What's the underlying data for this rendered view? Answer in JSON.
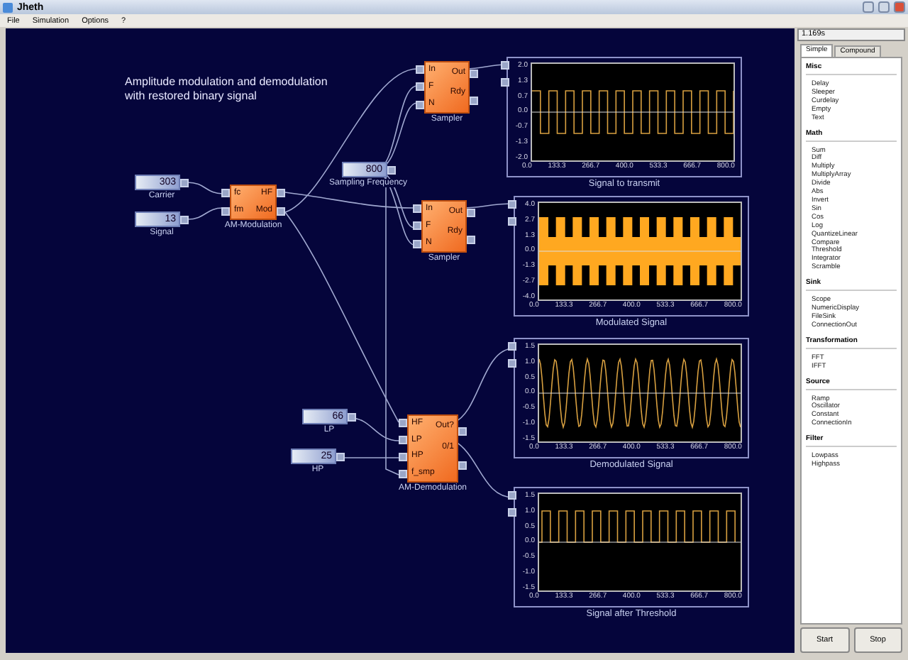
{
  "window": {
    "title": "Jheth"
  },
  "menu": [
    "File",
    "Simulation",
    "Options",
    "?"
  ],
  "canvas": {
    "caption_lines": [
      "Amplitude modulation and demodulation",
      "with restored binary signal"
    ],
    "constants": [
      {
        "label": "Carrier",
        "value": "303"
      },
      {
        "label": "Signal",
        "value": "13"
      },
      {
        "label": "Sampling Frequency",
        "value": "800"
      },
      {
        "label": "LP",
        "value": "66"
      },
      {
        "label": "HP",
        "value": "25"
      }
    ],
    "blocks": [
      {
        "name": "AM-Modulation",
        "inputs": [
          "fc",
          "fm"
        ],
        "outputs": [
          "HF",
          "Mod"
        ]
      },
      {
        "name": "Sampler",
        "inputs": [
          "In",
          "F",
          "N"
        ],
        "outputs": [
          "Out",
          "Rdy"
        ]
      },
      {
        "name": "Sampler",
        "inputs": [
          "In",
          "F",
          "N"
        ],
        "outputs": [
          "Out",
          "Rdy"
        ]
      },
      {
        "name": "AM-Demodulation",
        "inputs": [
          "HF",
          "LP",
          "HP",
          "f_smp"
        ],
        "outputs": [
          "Out?",
          "0/1"
        ]
      }
    ],
    "scopes": [
      {
        "title": "Signal to transmit",
        "kind": "square",
        "yticks": [
          "2.0",
          "1.3",
          "0.7",
          "0.0",
          "-0.7",
          "-1.3",
          "-2.0"
        ],
        "xticks": [
          "0.0",
          "133.3",
          "266.7",
          "400.0",
          "533.3",
          "666.7",
          "800.0"
        ]
      },
      {
        "title": "Modulated Signal",
        "kind": "am",
        "yticks": [
          "4.0",
          "2.7",
          "1.3",
          "0.0",
          "-1.3",
          "-2.7",
          "-4.0"
        ],
        "xticks": [
          "0.0",
          "133.3",
          "266.7",
          "400.0",
          "533.3",
          "666.7",
          "800.0"
        ]
      },
      {
        "title": "Demodulated Signal",
        "kind": "sine",
        "yticks": [
          "1.5",
          "1.0",
          "0.5",
          "0.0",
          "-0.5",
          "-1.0",
          "-1.5"
        ],
        "xticks": [
          "0.0",
          "133.3",
          "266.7",
          "400.0",
          "533.3",
          "666.7",
          "800.0"
        ]
      },
      {
        "title": "Signal after Threshold",
        "kind": "pulse",
        "yticks": [
          "1.5",
          "1.0",
          "0.5",
          "0.0",
          "-0.5",
          "-1.0",
          "-1.5"
        ],
        "xticks": [
          "0.0",
          "133.3",
          "266.7",
          "400.0",
          "533.3",
          "666.7",
          "800.0"
        ]
      }
    ]
  },
  "panel": {
    "time": "1.169s",
    "tabs": [
      {
        "label": "Simple",
        "selected": true
      },
      {
        "label": "Compound",
        "selected": false
      }
    ],
    "groups": [
      {
        "title": "Misc",
        "items": [
          "Delay",
          "Sleeper",
          "Curdelay",
          "Empty",
          "Text"
        ]
      },
      {
        "title": "Math",
        "items": [
          "Sum",
          "Diff",
          "Multiply",
          "MultiplyArray",
          "Divide",
          "Abs",
          "Invert",
          "Sin",
          "Cos",
          "Log",
          "QuantizeLinear",
          "Compare",
          "Threshold",
          "Integrator",
          "Scramble"
        ]
      },
      {
        "title": "Sink",
        "items": [
          "Scope",
          "NumericDisplay",
          "FileSink",
          "ConnectionOut"
        ]
      },
      {
        "title": "Transformation",
        "items": [
          "FFT",
          "IFFT"
        ]
      },
      {
        "title": "Source",
        "items": [
          "Ramp",
          "Oscillator",
          "Constant",
          "ConnectionIn"
        ]
      },
      {
        "title": "Filter",
        "items": [
          "Lowpass",
          "Highpass"
        ]
      }
    ],
    "buttons": [
      "Start",
      "Stop"
    ]
  }
}
